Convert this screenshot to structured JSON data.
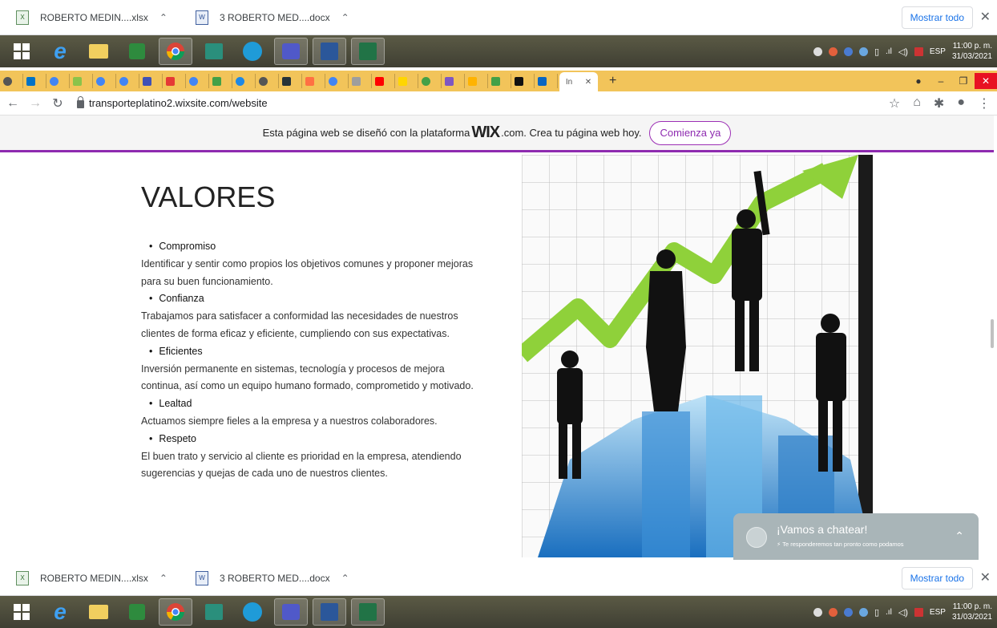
{
  "downloads": {
    "items": [
      {
        "name": "ROBERTO MEDIN....xlsx",
        "icon": "excel-file-icon"
      },
      {
        "name": "3 ROBERTO MED....docx",
        "icon": "word-file-icon"
      }
    ],
    "show_all": "Mostrar todo",
    "close": "✕",
    "caret": "^"
  },
  "taskbar": {
    "language": "ESP",
    "time": "11:00 p. m.",
    "date": "31/03/2021"
  },
  "tabs": {
    "active_label": "In",
    "active_close": "✕",
    "new_tab": "+"
  },
  "address": {
    "url": "transporteplatino2.wixsite.com/website"
  },
  "wix_banner": {
    "text_before": "Esta página web se diseñó con la plataforma",
    "logo": "WIX",
    "text_after": ".com. Crea tu página web hoy.",
    "button": "Comienza ya",
    "accent_color": "#8e2bb0"
  },
  "content": {
    "heading": "VALORES",
    "values": [
      {
        "title": "Compromiso",
        "description": "Identificar y sentir como propios los objetivos comunes y proponer mejoras para su buen funcionamiento."
      },
      {
        "title": "Confianza",
        "description": "Trabajamos para satisfacer a conformidad las necesidades de nuestros clientes de forma eficaz y eficiente, cumpliendo con sus expectativas."
      },
      {
        "title": "Eficientes",
        "description": "Inversión permanente en sistemas, tecnología y procesos de mejora continua, así como un equipo humano formado, comprometido y motivado."
      },
      {
        "title": "Lealtad",
        "description": "Actuamos siempre fieles a la empresa y a nuestros colaboradores."
      },
      {
        "title": "Respeto",
        "description": "El buen trato y servicio al cliente es prioridad en la empresa, atendiendo sugerencias y quejas de cada uno de nuestros clientes."
      }
    ]
  },
  "chat": {
    "title": "¡Vamos a chatear!",
    "subtitle": "Te responderemos tan pronto como podamos"
  }
}
